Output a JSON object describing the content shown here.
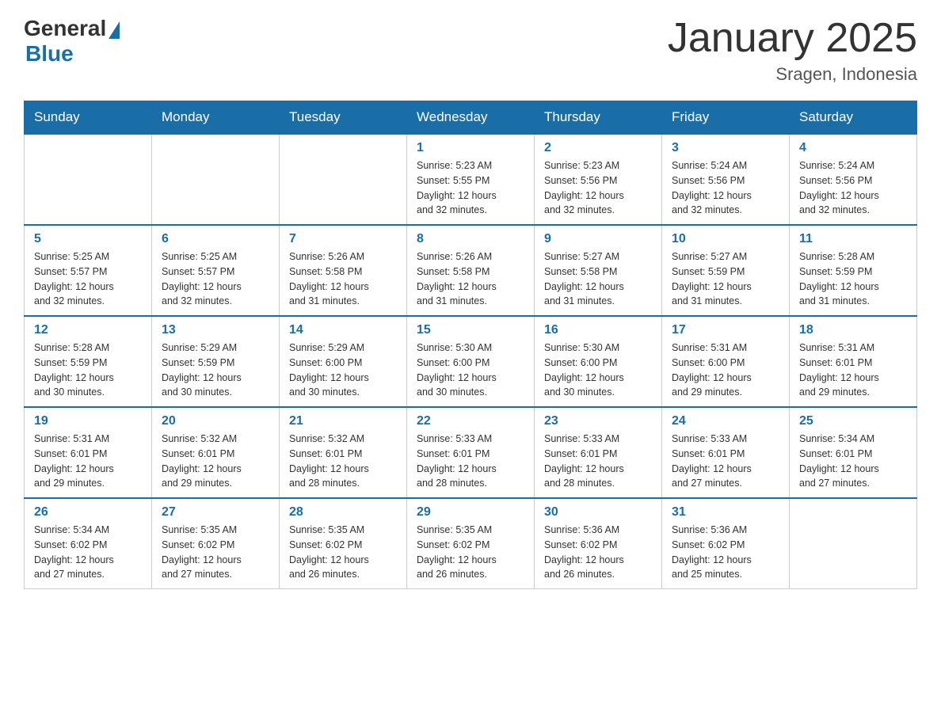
{
  "logo": {
    "general": "General",
    "blue": "Blue"
  },
  "title": "January 2025",
  "location": "Sragen, Indonesia",
  "days": [
    "Sunday",
    "Monday",
    "Tuesday",
    "Wednesday",
    "Thursday",
    "Friday",
    "Saturday"
  ],
  "weeks": [
    [
      {
        "day": "",
        "info": ""
      },
      {
        "day": "",
        "info": ""
      },
      {
        "day": "",
        "info": ""
      },
      {
        "day": "1",
        "info": "Sunrise: 5:23 AM\nSunset: 5:55 PM\nDaylight: 12 hours\nand 32 minutes."
      },
      {
        "day": "2",
        "info": "Sunrise: 5:23 AM\nSunset: 5:56 PM\nDaylight: 12 hours\nand 32 minutes."
      },
      {
        "day": "3",
        "info": "Sunrise: 5:24 AM\nSunset: 5:56 PM\nDaylight: 12 hours\nand 32 minutes."
      },
      {
        "day": "4",
        "info": "Sunrise: 5:24 AM\nSunset: 5:56 PM\nDaylight: 12 hours\nand 32 minutes."
      }
    ],
    [
      {
        "day": "5",
        "info": "Sunrise: 5:25 AM\nSunset: 5:57 PM\nDaylight: 12 hours\nand 32 minutes."
      },
      {
        "day": "6",
        "info": "Sunrise: 5:25 AM\nSunset: 5:57 PM\nDaylight: 12 hours\nand 32 minutes."
      },
      {
        "day": "7",
        "info": "Sunrise: 5:26 AM\nSunset: 5:58 PM\nDaylight: 12 hours\nand 31 minutes."
      },
      {
        "day": "8",
        "info": "Sunrise: 5:26 AM\nSunset: 5:58 PM\nDaylight: 12 hours\nand 31 minutes."
      },
      {
        "day": "9",
        "info": "Sunrise: 5:27 AM\nSunset: 5:58 PM\nDaylight: 12 hours\nand 31 minutes."
      },
      {
        "day": "10",
        "info": "Sunrise: 5:27 AM\nSunset: 5:59 PM\nDaylight: 12 hours\nand 31 minutes."
      },
      {
        "day": "11",
        "info": "Sunrise: 5:28 AM\nSunset: 5:59 PM\nDaylight: 12 hours\nand 31 minutes."
      }
    ],
    [
      {
        "day": "12",
        "info": "Sunrise: 5:28 AM\nSunset: 5:59 PM\nDaylight: 12 hours\nand 30 minutes."
      },
      {
        "day": "13",
        "info": "Sunrise: 5:29 AM\nSunset: 5:59 PM\nDaylight: 12 hours\nand 30 minutes."
      },
      {
        "day": "14",
        "info": "Sunrise: 5:29 AM\nSunset: 6:00 PM\nDaylight: 12 hours\nand 30 minutes."
      },
      {
        "day": "15",
        "info": "Sunrise: 5:30 AM\nSunset: 6:00 PM\nDaylight: 12 hours\nand 30 minutes."
      },
      {
        "day": "16",
        "info": "Sunrise: 5:30 AM\nSunset: 6:00 PM\nDaylight: 12 hours\nand 30 minutes."
      },
      {
        "day": "17",
        "info": "Sunrise: 5:31 AM\nSunset: 6:00 PM\nDaylight: 12 hours\nand 29 minutes."
      },
      {
        "day": "18",
        "info": "Sunrise: 5:31 AM\nSunset: 6:01 PM\nDaylight: 12 hours\nand 29 minutes."
      }
    ],
    [
      {
        "day": "19",
        "info": "Sunrise: 5:31 AM\nSunset: 6:01 PM\nDaylight: 12 hours\nand 29 minutes."
      },
      {
        "day": "20",
        "info": "Sunrise: 5:32 AM\nSunset: 6:01 PM\nDaylight: 12 hours\nand 29 minutes."
      },
      {
        "day": "21",
        "info": "Sunrise: 5:32 AM\nSunset: 6:01 PM\nDaylight: 12 hours\nand 28 minutes."
      },
      {
        "day": "22",
        "info": "Sunrise: 5:33 AM\nSunset: 6:01 PM\nDaylight: 12 hours\nand 28 minutes."
      },
      {
        "day": "23",
        "info": "Sunrise: 5:33 AM\nSunset: 6:01 PM\nDaylight: 12 hours\nand 28 minutes."
      },
      {
        "day": "24",
        "info": "Sunrise: 5:33 AM\nSunset: 6:01 PM\nDaylight: 12 hours\nand 27 minutes."
      },
      {
        "day": "25",
        "info": "Sunrise: 5:34 AM\nSunset: 6:01 PM\nDaylight: 12 hours\nand 27 minutes."
      }
    ],
    [
      {
        "day": "26",
        "info": "Sunrise: 5:34 AM\nSunset: 6:02 PM\nDaylight: 12 hours\nand 27 minutes."
      },
      {
        "day": "27",
        "info": "Sunrise: 5:35 AM\nSunset: 6:02 PM\nDaylight: 12 hours\nand 27 minutes."
      },
      {
        "day": "28",
        "info": "Sunrise: 5:35 AM\nSunset: 6:02 PM\nDaylight: 12 hours\nand 26 minutes."
      },
      {
        "day": "29",
        "info": "Sunrise: 5:35 AM\nSunset: 6:02 PM\nDaylight: 12 hours\nand 26 minutes."
      },
      {
        "day": "30",
        "info": "Sunrise: 5:36 AM\nSunset: 6:02 PM\nDaylight: 12 hours\nand 26 minutes."
      },
      {
        "day": "31",
        "info": "Sunrise: 5:36 AM\nSunset: 6:02 PM\nDaylight: 12 hours\nand 25 minutes."
      },
      {
        "day": "",
        "info": ""
      }
    ]
  ]
}
